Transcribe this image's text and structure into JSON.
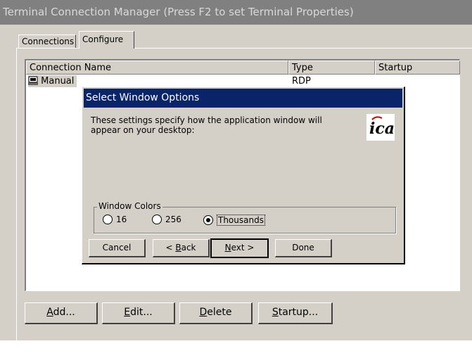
{
  "window": {
    "title": "Terminal Connection Manager (Press F2 to set Terminal Properties)"
  },
  "tabs": [
    {
      "label": "Connections"
    },
    {
      "label": "Configure"
    }
  ],
  "list": {
    "columns": [
      "Connection Name",
      "Type",
      "Startup"
    ],
    "rows": [
      {
        "name": "Manual",
        "type": "RDP",
        "startup": ""
      }
    ]
  },
  "dialog": {
    "title": "Select Window Options",
    "description": "These settings specify how the application window will appear on your desktop:",
    "logo_text": "ica",
    "group_label": "Window Colors",
    "options": [
      "16",
      "256",
      "Thousands"
    ],
    "selected": "Thousands",
    "buttons": {
      "cancel": {
        "label": "Cancel"
      },
      "back": {
        "pre": "< ",
        "mnemonic": "B",
        "post": "ack"
      },
      "next": {
        "pre": "",
        "mnemonic": "N",
        "post": "ext >"
      },
      "done": {
        "label": "Done"
      }
    }
  },
  "bottom_buttons": {
    "add": {
      "mnemonic": "A",
      "rest": "dd..."
    },
    "edit": {
      "mnemonic": "E",
      "rest": "dit..."
    },
    "delete": {
      "mnemonic": "D",
      "rest": "elete"
    },
    "startup": {
      "mnemonic": "S",
      "rest": "tartup..."
    }
  },
  "colors": {
    "title_bar": "#808080",
    "dialog_title": "#0a246a",
    "face": "#d4d0c8"
  }
}
